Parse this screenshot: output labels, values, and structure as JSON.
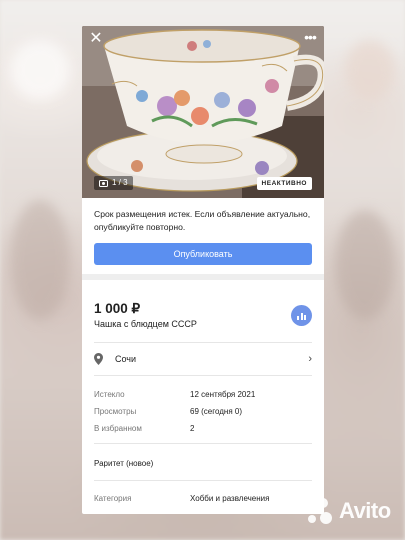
{
  "photo": {
    "counter": "1 / 3",
    "status_badge": "НЕАКТИВНО"
  },
  "notice": {
    "text": "Срок размещения истек. Если объявление актуально, опубликуйте повторно.",
    "publish_label": "Опубликовать"
  },
  "listing": {
    "price": "1 000 ₽",
    "title": "Чашка с блюдцем СССР",
    "location": "Сочи"
  },
  "details": [
    {
      "label": "Истекло",
      "value": "12 сентября 2021"
    },
    {
      "label": "Просмотры",
      "value": "69 (сегодня 0)"
    },
    {
      "label": "В избранном",
      "value": "2"
    }
  ],
  "condition": "Раритет (новое)",
  "category": {
    "label": "Категория",
    "value": "Хобби и развлечения"
  },
  "watermark": "Avito",
  "colors": {
    "accent": "#5b8ff0",
    "stats_button": "#6f93e8"
  },
  "icons": [
    "close-icon",
    "more-icon",
    "camera-icon",
    "location-pin-icon",
    "chevron-right-icon",
    "stats-icon"
  ]
}
